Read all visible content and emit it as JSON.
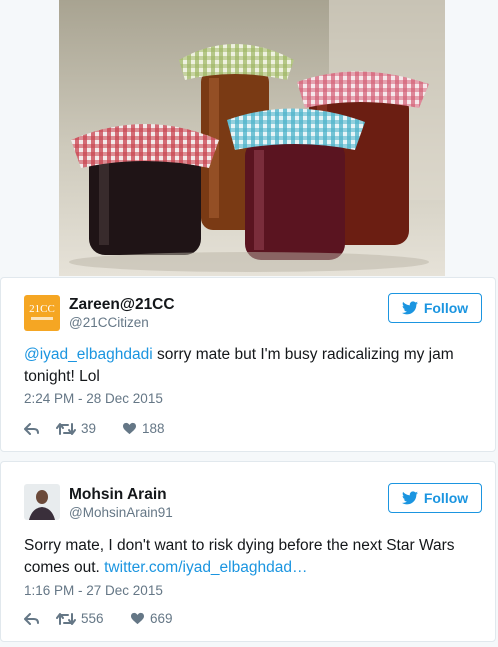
{
  "tweets": [
    {
      "name": "Zareen@21CC",
      "handle": "@21CCitizen",
      "avatar_text": "21CC",
      "follow_label": "Follow",
      "mention": "@iyad_elbaghdadi",
      "text": " sorry mate but I'm busy radicalizing my jam tonight! Lol",
      "time": "2:24 PM - 28 Dec 2015",
      "retweets": "39",
      "likes": "188"
    },
    {
      "name": "Mohsin Arain",
      "handle": "@MohsinArain91",
      "follow_label": "Follow",
      "text": "Sorry mate, I don't want to risk dying before the next Star Wars comes out. ",
      "link": "twitter.com/iyad_elbaghdad…",
      "time": "1:16 PM - 27 Dec 2015",
      "retweets": "556",
      "likes": "669"
    }
  ],
  "colors": {
    "accent": "#1b95e0",
    "muted": "#657786",
    "avatar_bg": "#f5a623"
  },
  "icons": [
    "twitter-bird-icon",
    "reply-icon",
    "retweet-icon",
    "heart-icon"
  ]
}
